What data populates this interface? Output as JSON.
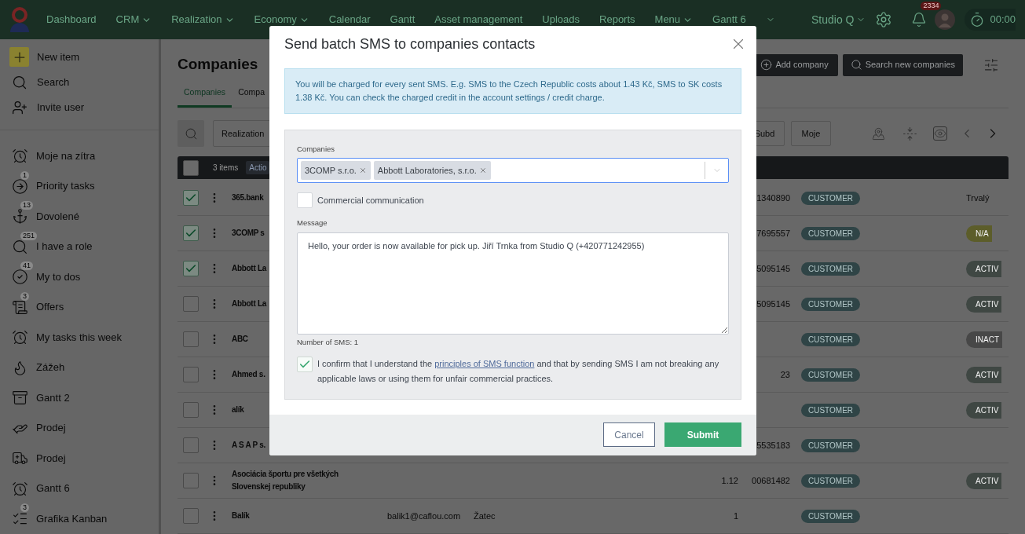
{
  "nav": {
    "items": [
      {
        "label": "Dashboard",
        "dropdown": false
      },
      {
        "label": "CRM",
        "dropdown": true
      },
      {
        "label": "Realization",
        "dropdown": true
      },
      {
        "label": "Economy",
        "dropdown": true
      },
      {
        "label": "Calendar",
        "dropdown": false
      },
      {
        "label": "Gantt",
        "dropdown": false
      },
      {
        "label": "Asset management",
        "dropdown": false
      },
      {
        "label": "Uploads",
        "dropdown": false
      },
      {
        "label": "Reports",
        "dropdown": false
      },
      {
        "label": "Menu",
        "dropdown": true
      },
      {
        "label": "Gantt 6",
        "dropdown": false
      }
    ],
    "workspace": "Studio Q",
    "notifications": "2334",
    "timer": "00:00"
  },
  "sidebar": {
    "actions": [
      {
        "label": "New item"
      },
      {
        "label": "Search"
      },
      {
        "label": "Invite user"
      }
    ],
    "items": [
      {
        "label": "Moje na zítra"
      },
      {
        "label": "Priority tasks",
        "badge": "1"
      },
      {
        "label": "Dovolené",
        "badge": "13"
      },
      {
        "label": "I have a role",
        "badge": "251"
      },
      {
        "label": "My to dos",
        "badge": "41"
      },
      {
        "label": "Offers",
        "badge": "3"
      },
      {
        "label": "My tasks this week"
      },
      {
        "label": "Zážeh"
      },
      {
        "label": "Gantt 2"
      },
      {
        "label": "Prodej"
      },
      {
        "label": "Prodej"
      },
      {
        "label": "Gantt 6"
      },
      {
        "label": "Grafika Kanban",
        "badge": "3"
      }
    ]
  },
  "page": {
    "title": "Companies",
    "add_button": "Add company",
    "search_button": "Search new companies",
    "tabs": [
      {
        "label": "Companies",
        "selected": true
      },
      {
        "label": "Compa",
        "selected": false
      }
    ],
    "filters": [
      "Realization"
    ],
    "quick_filters": [
      "Subd",
      "Moje"
    ]
  },
  "table": {
    "all_selected": false,
    "selection_count": "3 items",
    "actions_label": "Actio",
    "rows": [
      {
        "selected": true,
        "name": "365.bank",
        "id": "1340890",
        "tag": "CUSTOMER",
        "status": {
          "kind": "plain",
          "label": "Trvalý"
        }
      },
      {
        "selected": true,
        "name": "3COMP s",
        "id": "7695557",
        "tag": "CUSTOMER",
        "status": {
          "kind": "pill",
          "label": "N/A",
          "color": "#5c5d2a"
        }
      },
      {
        "selected": true,
        "name": "Abbott La",
        "id": "5095145",
        "tag": "CUSTOMER",
        "status": {
          "kind": "pill",
          "label": "ACTIV",
          "color": "#3f4743"
        }
      },
      {
        "selected": false,
        "name": "Abbott La",
        "id": "5095145",
        "tag": "CUSTOMER",
        "status": {
          "kind": "pill",
          "label": "ACTIV",
          "color": "#3f4743"
        }
      },
      {
        "selected": false,
        "name": "ABC",
        "tag": "CUSTOMER",
        "status": {
          "kind": "pill",
          "label": "INACT",
          "color": "#474747"
        }
      },
      {
        "selected": false,
        "name": "Ahmed s.",
        "id": "23",
        "tag": "CUSTOMER",
        "status": {
          "kind": "pill",
          "label": "ACTIV",
          "color": "#3f4743"
        }
      },
      {
        "selected": false,
        "name": "alík",
        "tag": "CUSTOMER",
        "status": {
          "kind": "pill",
          "label": "ACTIV",
          "color": "#3f4743"
        }
      },
      {
        "selected": false,
        "name": "A S A P s.",
        "id": "5535183",
        "tag": "CUSTOMER"
      },
      {
        "selected": false,
        "name": "Asociácia športu pre všetkých Slovenskej republiky",
        "count": "1.12",
        "id": "00681482",
        "tag": "CUSTOMER",
        "status": {
          "kind": "pill",
          "label": "ACTIV",
          "color": "#3f4743"
        }
      },
      {
        "selected": false,
        "name": "Balík",
        "email": "balik1@caflou.com",
        "city": "Žatec",
        "count": "1",
        "tag": "CUSTOMER"
      }
    ]
  },
  "modal": {
    "title": "Send batch SMS to companies contacts",
    "notice": "You will be charged for every sent SMS. E.g. SMS to the Czech Republic costs about 1.43 Kč, SMS to SK costs 1.38 Kč. You can check the charged credit in the account settings / credit charge.",
    "companies_label": "Companies",
    "companies": [
      "3COMP s.r.o.",
      "Abbott Laboratories, s.r.o."
    ],
    "commercial": {
      "label": "Commercial communication",
      "checked": false
    },
    "message_label": "Message",
    "message": "Hello, your order is now available for pick up. Jiří Trnka from Studio Q (+420771242955)",
    "sms_count": "Number of SMS: 1",
    "confirm": {
      "checked": true,
      "before": "I confirm that I understand the ",
      "link": "principles of SMS function",
      "after": " and that by sending SMS I am not breaking any applicable laws or using them for unfair commercial practices."
    },
    "buttons": {
      "cancel": "Cancel",
      "submit": "Submit"
    }
  }
}
